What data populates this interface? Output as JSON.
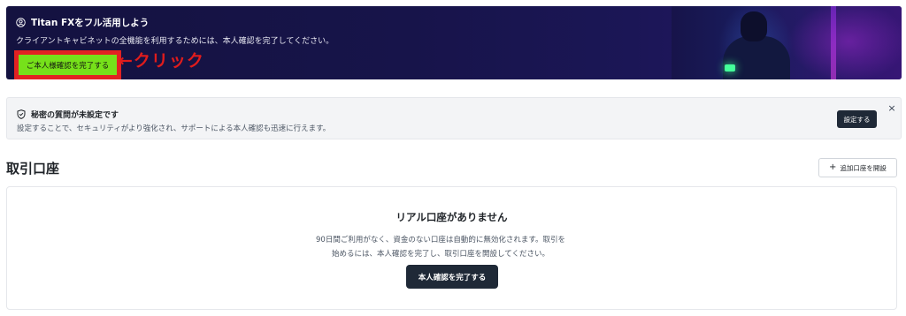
{
  "banner": {
    "title": "Titan FXをフル活用しよう",
    "description": "クライアントキャビネットの全機能を利用するためには、本人確認を完了してください。",
    "cta_label": "ご本人様確認を完了する",
    "annotation": "←クリック",
    "user_icon": "user-circle-icon"
  },
  "notice": {
    "title": "秘密の質問が未設定です",
    "description": "設定することで、セキュリティがより強化され、サポートによる本人確認も迅速に行えます。",
    "action_label": "設定する",
    "close_glyph": "×",
    "shield_icon": "shield-check-icon"
  },
  "accounts": {
    "title": "取引口座",
    "add_button_icon": "+",
    "add_button_label": "追加口座を開設"
  },
  "empty_state": {
    "title": "リアル口座がありません",
    "description": "90日間ご利用がなく、資金のない口座は自動的に無効化されます。取引を始めるには、本人確認を完了し、取引口座を開設してください。",
    "cta_label": "本人確認を完了する"
  },
  "colors": {
    "banner_bg": "#17144a",
    "cta_green": "#76e11a",
    "annotation_red": "#e01c1c",
    "dark_button": "#1f2937"
  }
}
